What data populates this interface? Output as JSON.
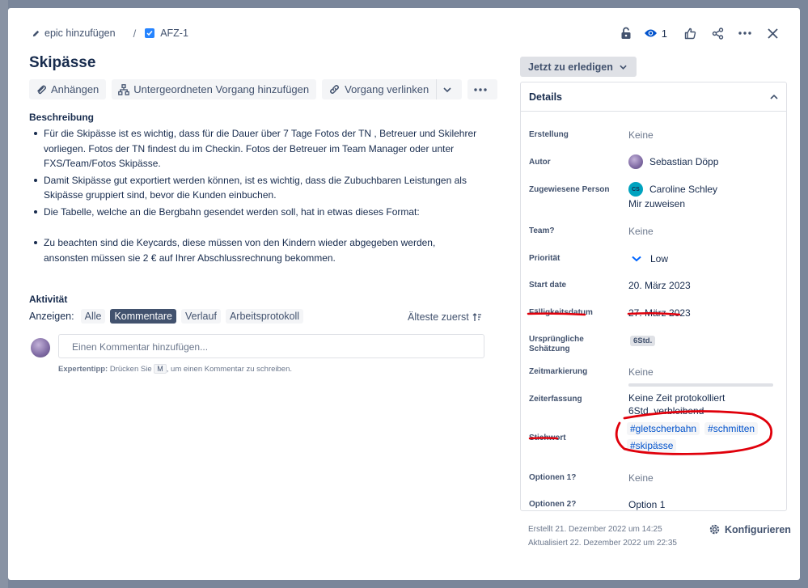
{
  "breadcrumb": {
    "epic_label": "epic hinzufügen",
    "separator": "/",
    "issue_key": "AFZ-1"
  },
  "header_actions": {
    "watch_count": "1"
  },
  "issue": {
    "title": "Skipässe"
  },
  "toolbar": {
    "attach_label": "Anhängen",
    "subtask_label": "Untergeordneten Vorgang hinzufügen",
    "link_label": "Vorgang verlinken"
  },
  "description": {
    "heading": "Beschreibung",
    "items": [
      "Für die Skipässe ist es wichtig, dass für die Dauer über 7 Tage Fotos der TN , Betreuer und Skilehrer vorliegen. Fotos der TN findest du im Checkin. Fotos der Betreuer im Team Manager oder unter FXS/Team/Fotos Skipässe.",
      "Damit Skipässe gut exportiert werden können, ist es wichtig, dass die Zubuchbaren Leistungen als Skipässe gruppiert sind, bevor die Kunden einbuchen.",
      "Die Tabelle, welche an die Bergbahn gesendet werden soll, hat in etwas dieses Format:",
      "Zu beachten sind die Keycards, diese müssen von den Kindern wieder abgegeben werden, ansonsten müssen sie 2 € auf Ihrer Abschlussrechnung bekommen."
    ]
  },
  "activity": {
    "heading": "Aktivität",
    "show_label": "Anzeigen:",
    "filters": [
      "Alle",
      "Kommentare",
      "Verlauf",
      "Arbeitsprotokoll"
    ],
    "active_filter": "Kommentare",
    "sort_label": "Älteste zuerst",
    "comment_placeholder": "Einen Kommentar hinzufügen...",
    "tip_bold": "Expertentipp:",
    "tip_pre": "Drücken Sie",
    "tip_key": "M",
    "tip_post": ", um einen Kommentar zu schreiben."
  },
  "status": {
    "label": "Jetzt zu erledigen"
  },
  "details": {
    "heading": "Details",
    "creation_label": "Erstellung",
    "creation_value": "Keine",
    "author_label": "Autor",
    "author_value": "Sebastian Döpp",
    "assignee_label": "Zugewiesene Person",
    "assignee_initials": "CS",
    "assignee_value": "Caroline Schley",
    "assign_me": "Mir zuweisen",
    "team_label": "Team?",
    "team_value": "Keine",
    "priority_label": "Priorität",
    "priority_value": "Low",
    "start_label": "Start date",
    "start_value": "20. März 2023",
    "due_label": "Fälligkeitsdatum",
    "due_value": "27. März 2023",
    "estimate_label_1": "Ursprüngliche",
    "estimate_label_2": "Schätzung",
    "estimate_value": "6Std.",
    "mark_label": "Zeitmarkierung",
    "mark_value": "Keine",
    "tracking_label": "Zeiterfassung",
    "tracking_logged": "Keine Zeit protokolliert",
    "tracking_remaining": "6Std. verbleibend",
    "labels_label": "Stichwort",
    "labels": [
      "#gletscherbahn",
      "#schmitten",
      "#skipässe"
    ],
    "opt1_label": "Optionen 1?",
    "opt1_value": "Keine",
    "opt2_label": "Optionen 2?",
    "opt2_value": "Option 1"
  },
  "meta": {
    "created": "Erstellt 21. Dezember 2022 um 14:25",
    "updated": "Aktualisiert 22. Dezember 2022 um 22:35",
    "configure": "Konfigurieren"
  },
  "colors": {
    "annotation_red": "#e0000b",
    "link_blue": "#0052cc",
    "active_chip": "#42526e"
  }
}
